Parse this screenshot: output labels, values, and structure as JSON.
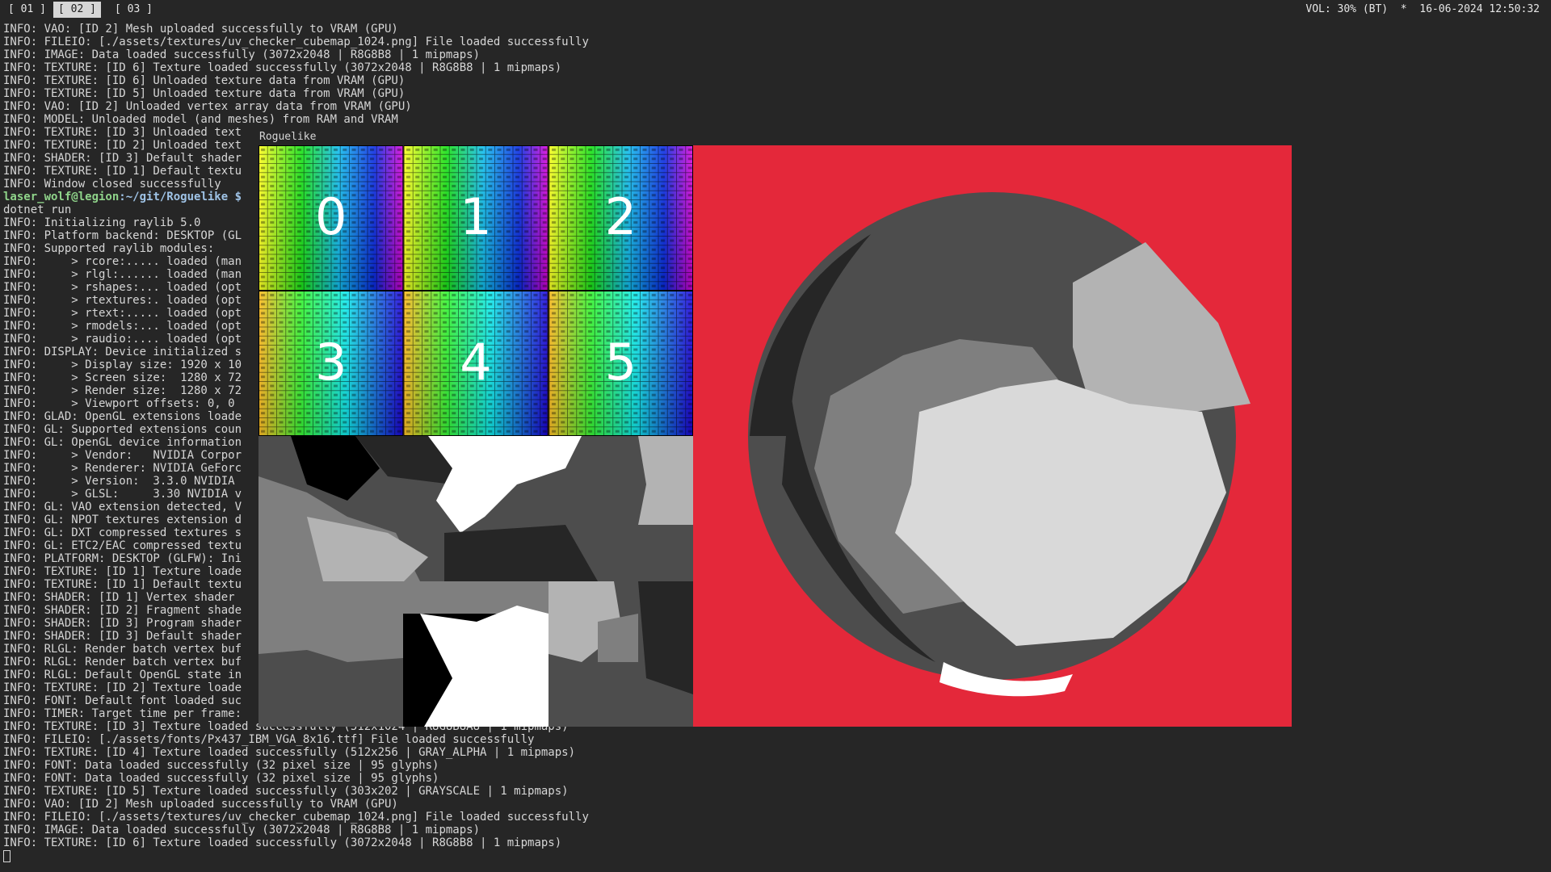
{
  "statusbar": {
    "workspaces": [
      {
        "label": "[ 01 ]"
      },
      {
        "label": "[ 02 ]"
      },
      {
        "label": "[ 03 ]"
      }
    ],
    "volume": "VOL: 30% (BT)",
    "separator": "*",
    "datetime": "16-06-2024 12:50:32"
  },
  "terminal": {
    "lines": [
      "INFO: VAO: [ID 2] Mesh uploaded successfully to VRAM (GPU)",
      "INFO: FILEIO: [./assets/textures/uv_checker_cubemap_1024.png] File loaded successfully",
      "INFO: IMAGE: Data loaded successfully (3072x2048 | R8G8B8 | 1 mipmaps)",
      "INFO: TEXTURE: [ID 6] Texture loaded successfully (3072x2048 | R8G8B8 | 1 mipmaps)",
      "INFO: TEXTURE: [ID 6] Unloaded texture data from VRAM (GPU)",
      "INFO: TEXTURE: [ID 5] Unloaded texture data from VRAM (GPU)",
      "INFO: VAO: [ID 2] Unloaded vertex array data from VRAM (GPU)",
      "INFO: MODEL: Unloaded model (and meshes) from RAM and VRAM",
      "INFO: TEXTURE: [ID 3] Unloaded text",
      "INFO: TEXTURE: [ID 2] Unloaded text",
      "INFO: SHADER: [ID 3] Default shader",
      "INFO: TEXTURE: [ID 1] Default textu",
      "INFO: Window closed successfully",
      "__PROMPT__",
      "dotnet run",
      "INFO: Initializing raylib 5.0",
      "INFO: Platform backend: DESKTOP (GL",
      "INFO: Supported raylib modules:",
      "INFO:     > rcore:..... loaded (man",
      "INFO:     > rlgl:...... loaded (man",
      "INFO:     > rshapes:... loaded (opt",
      "INFO:     > rtextures:. loaded (opt",
      "INFO:     > rtext:..... loaded (opt",
      "INFO:     > rmodels:... loaded (opt",
      "INFO:     > raudio:.... loaded (opt",
      "INFO: DISPLAY: Device initialized s",
      "INFO:     > Display size: 1920 x 10",
      "INFO:     > Screen size:  1280 x 72",
      "INFO:     > Render size:  1280 x 72",
      "INFO:     > Viewport offsets: 0, 0",
      "INFO: GLAD: OpenGL extensions loade",
      "INFO: GL: Supported extensions coun",
      "INFO: GL: OpenGL device information",
      "INFO:     > Vendor:   NVIDIA Corpor",
      "INFO:     > Renderer: NVIDIA GeForc",
      "INFO:     > Version:  3.3.0 NVIDIA",
      "INFO:     > GLSL:     3.30 NVIDIA v",
      "INFO: GL: VAO extension detected, V",
      "INFO: GL: NPOT textures extension d",
      "INFO: GL: DXT compressed textures s",
      "INFO: GL: ETC2/EAC compressed textu",
      "INFO: PLATFORM: DESKTOP (GLFW): Ini",
      "INFO: TEXTURE: [ID 1] Texture loade",
      "INFO: TEXTURE: [ID 1] Default textu",
      "INFO: SHADER: [ID 1] Vertex shader",
      "INFO: SHADER: [ID 2] Fragment shade",
      "INFO: SHADER: [ID 3] Program shader",
      "INFO: SHADER: [ID 3] Default shader",
      "INFO: RLGL: Render batch vertex buf",
      "INFO: RLGL: Render batch vertex buf",
      "INFO: RLGL: Default OpenGL state in",
      "INFO: TEXTURE: [ID 2] Texture loade",
      "INFO: FONT: Default font loaded suc",
      "INFO: TIMER: Target time per frame:",
      "INFO: TEXTURE: [ID 3] Texture loaded successfully (512x1024 | R8G8B8A8 | 1 mipmaps)",
      "INFO: FILEIO: [./assets/fonts/Px437_IBM_VGA_8x16.ttf] File loaded successfully",
      "INFO: TEXTURE: [ID 4] Texture loaded successfully (512x256 | GRAY_ALPHA | 1 mipmaps)",
      "INFO: FONT: Data loaded successfully (32 pixel size | 95 glyphs)",
      "INFO: FONT: Data loaded successfully (32 pixel size | 95 glyphs)",
      "INFO: TEXTURE: [ID 5] Texture loaded successfully (303x202 | GRAYSCALE | 1 mipmaps)",
      "INFO: VAO: [ID 2] Mesh uploaded successfully to VRAM (GPU)",
      "INFO: FILEIO: [./assets/textures/uv_checker_cubemap_1024.png] File loaded successfully",
      "INFO: IMAGE: Data loaded successfully (3072x2048 | R8G8B8 | 1 mipmaps)",
      "INFO: TEXTURE: [ID 6] Texture loaded successfully (3072x2048 | R8G8B8 | 1 mipmaps)"
    ],
    "prompt": {
      "user": "laser_wolf@legion",
      "path": ":~/git/Roguelike",
      "symbol": " $"
    }
  },
  "game_window": {
    "title": "Roguelike",
    "cubemap_faces": [
      "0",
      "1",
      "2",
      "3",
      "4",
      "5"
    ],
    "colors": {
      "viewport_background": "#e4283a",
      "sphere_dark": "#262626",
      "sphere_mid": "#4d4d4d",
      "sphere_light": "#7f7f7f",
      "sphere_lighter": "#b3b3b3",
      "sphere_lightest": "#d9d9d9"
    }
  }
}
